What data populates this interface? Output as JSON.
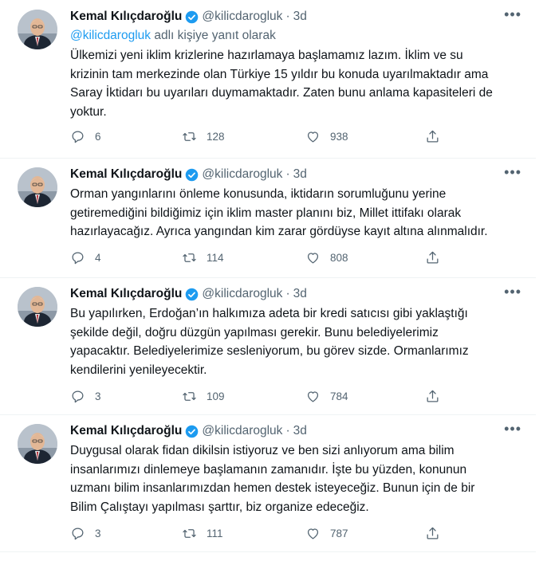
{
  "author": {
    "name": "Kemal Kılıçdaroğlu",
    "handle": "@kilicdarogluk",
    "verified": true
  },
  "colors": {
    "accent": "#1d9bf0",
    "text": "#0f1419",
    "secondary": "#536471"
  },
  "tweets": [
    {
      "time": "3d",
      "reply_mention": "@kilicdarogluk",
      "reply_suffix": " adlı kişiye yanıt olarak",
      "text": "Ülkemizi yeni iklim krizlerine hazırlamaya başlamamız lazım. İklim ve su\nkrizinin tam merkezinde olan Türkiye 15 yıldır bu konuda uyarılmaktadır ama\nSaray İktidarı bu uyarıları duymamaktadır. Zaten bunu anlama kapasiteleri de\nyoktur.",
      "replies": "6",
      "retweets": "128",
      "likes": "938"
    },
    {
      "time": "3d",
      "text": "Orman yangınlarını önleme konusunda, iktidarın sorumluğunu yerine\ngetiremediğini bildiğimiz için iklim master planını biz, Millet ittifakı olarak\nhazırlayacağız. Ayrıca yangından kim zarar gördüyse kayıt altına alınmalıdır.",
      "replies": "4",
      "retweets": "114",
      "likes": "808"
    },
    {
      "time": "3d",
      "text": "Bu yapılırken, Erdoğan’ın halkımıza adeta bir kredi satıcısı gibi yaklaştığı\nşekilde değil, doğru düzgün yapılması gerekir. Bunu belediyelerimiz\nyapacaktır. Belediyelerimize sesleniyorum, bu görev sizde. Ormanlarımız\nkendilerini yenileyecektir.",
      "replies": "3",
      "retweets": "109",
      "likes": "784"
    },
    {
      "time": "3d",
      "text": "Duygusal olarak fidan dikilsin istiyoruz ve ben sizi anlıyorum ama bilim\ninsanlarımızı dinlemeye başlamanın zamanıdır. İşte bu yüzden, konunun\nuzmanı bilim insanlarımızdan hemen destek isteyeceğiz. Bunun için de bir\nBilim Çalıştayı yapılması şarttır, biz organize edeceğiz.",
      "replies": "3",
      "retweets": "111",
      "likes": "787"
    }
  ],
  "icons": {
    "more": "more-icon",
    "reply": "reply-icon",
    "retweet": "retweet-icon",
    "like": "heart-icon",
    "share": "share-icon",
    "verified": "verified-badge-icon"
  }
}
